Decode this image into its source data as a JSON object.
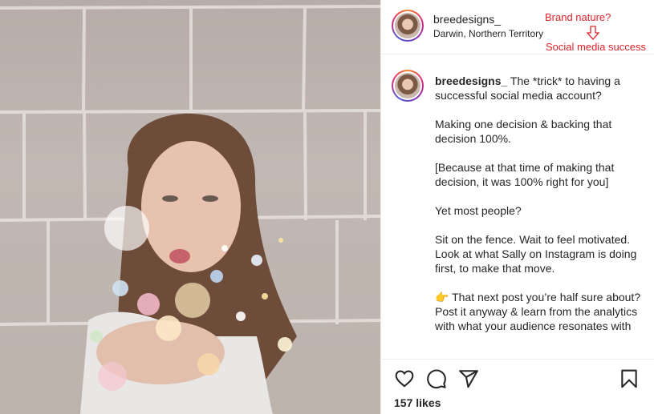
{
  "post": {
    "username": "breedesigns_",
    "location": "Darwin, Northern Territory",
    "caption_text": "The *trick* to having a successful social media account?\n\nMaking one decision & backing that decision 100%.\n\n[Because at that time of making that decision, it was 100% right for you]\n\nYet most people?\n\nSit on the fence. Wait to feel motivated. Look at what Sally on Instagram is doing first, to make that move.\n\n👉 That next post you’re half sure about? Post it anyway & learn from the analytics with what your audience resonates with",
    "likes": "157 likes"
  },
  "annotations": {
    "brand_nature": "Brand nature?",
    "social_media_success": "Social media success"
  },
  "icons": [
    "heart-icon",
    "comment-icon",
    "share-icon",
    "bookmark-icon",
    "arrow-down-icon"
  ],
  "colors": {
    "annotation": "#e0242a",
    "text": "#262626",
    "divider": "#efefef"
  }
}
